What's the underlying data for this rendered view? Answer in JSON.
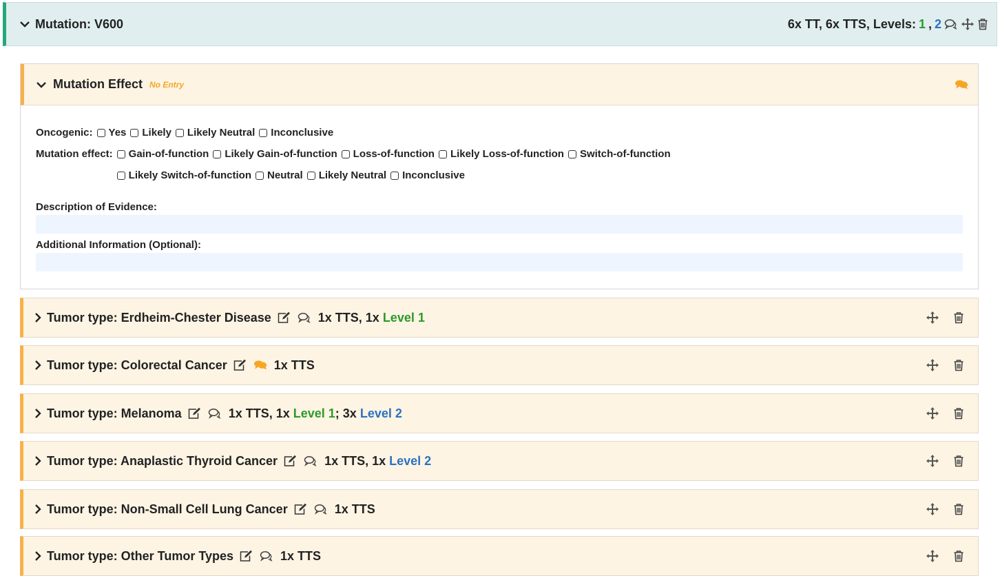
{
  "mutation": {
    "title": "Mutation: V600",
    "summary_prefix": "6x TT, 6x TTS, Levels:",
    "level_1": "1",
    "comma": ",",
    "level_2": "2"
  },
  "mutation_effect": {
    "title": "Mutation Effect",
    "no_entry": "No Entry",
    "oncogenic_label": "Oncogenic:",
    "oncogenic_options": [
      "Yes",
      "Likely",
      "Likely Neutral",
      "Inconclusive"
    ],
    "mutation_effect_label": "Mutation effect:",
    "mutation_effect_options": [
      "Gain-of-function",
      "Likely Gain-of-function",
      "Loss-of-function",
      "Likely Loss-of-function",
      "Switch-of-function",
      "Likely Switch-of-function",
      "Neutral",
      "Likely Neutral",
      "Inconclusive"
    ],
    "description_label": "Description of Evidence:",
    "description_value": "",
    "additional_label": "Additional Information (Optional):",
    "additional_value": ""
  },
  "tumor_types": [
    {
      "title": "Tumor type: Erdheim-Chester Disease",
      "summary": "1x TTS, 1x",
      "level1": "Level 1"
    },
    {
      "title": "Tumor type: Colorectal Cancer",
      "summary": "1x TTS"
    },
    {
      "title": "Tumor type: Melanoma",
      "summary": "1x TTS, 1x",
      "level1": "Level 1",
      "mid": "; 3x",
      "level2": "Level 2"
    },
    {
      "title": "Tumor type: Anaplastic Thyroid Cancer",
      "summary": "1x TTS, 1x",
      "level2": "Level 2"
    },
    {
      "title": "Tumor type: Non-Small Cell Lung Cancer",
      "summary": "1x TTS"
    },
    {
      "title": "Tumor type: Other Tumor Types",
      "summary": "1x TTS"
    }
  ],
  "colors": {
    "level1": "#2a9a2a",
    "level2": "#2a72c2",
    "accent_orange": "#f9b04a",
    "mutation_bar": "#24a87b",
    "comment_active": "#f5a623"
  },
  "icons": [
    "chevron-down-icon",
    "chevron-right-icon",
    "comment-icon",
    "move-icon",
    "trash-icon",
    "edit-icon"
  ]
}
